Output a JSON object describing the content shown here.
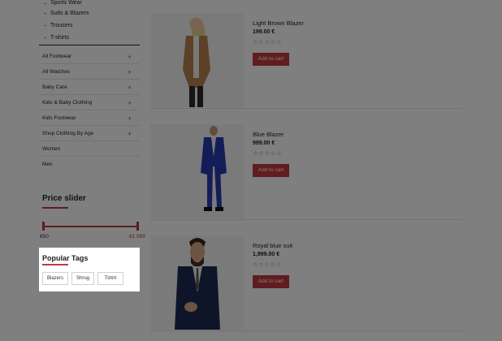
{
  "sidebar": {
    "subcategories": [
      "Sports Wear",
      "Suits & Blazers",
      "Trousers",
      "T-shirts"
    ],
    "categories": [
      {
        "label": "All Footwear",
        "expand": "+"
      },
      {
        "label": "All Watches",
        "expand": "+"
      },
      {
        "label": "Baby Care",
        "expand": "+"
      },
      {
        "label": "Kids & Baby Clothing",
        "expand": "+"
      },
      {
        "label": "Kids Footwear",
        "expand": "+"
      },
      {
        "label": "Shop Clothing By Age",
        "expand": "+"
      },
      {
        "label": "Women",
        "expand": ""
      },
      {
        "label": "Men",
        "expand": ""
      }
    ]
  },
  "price_slider": {
    "title": "Price slider",
    "min_label": "€50",
    "max_label": "€1 999"
  },
  "popular_tags": {
    "title": "Popular Tags",
    "tags": [
      "Blazers",
      "Shrug",
      "Tshirt"
    ]
  },
  "products": [
    {
      "name": "Light Brown Blazer",
      "price": "199.00 €",
      "rating": "☆☆☆☆☆",
      "button": "Add to cart",
      "image": "woman-brown-blazer"
    },
    {
      "name": "Blue Blazer",
      "price": "999.00 €",
      "rating": "☆☆☆☆☆",
      "button": "Add to cart",
      "image": "man-blue-suit"
    },
    {
      "name": "Royal blue suit",
      "price": "1,999.00 €",
      "rating": "☆☆☆☆☆",
      "button": "Add to cart",
      "image": "man-navy-suit"
    }
  ],
  "colors": {
    "accent": "#c0393c",
    "overlay": "rgba(0,0,0,0.5)"
  }
}
